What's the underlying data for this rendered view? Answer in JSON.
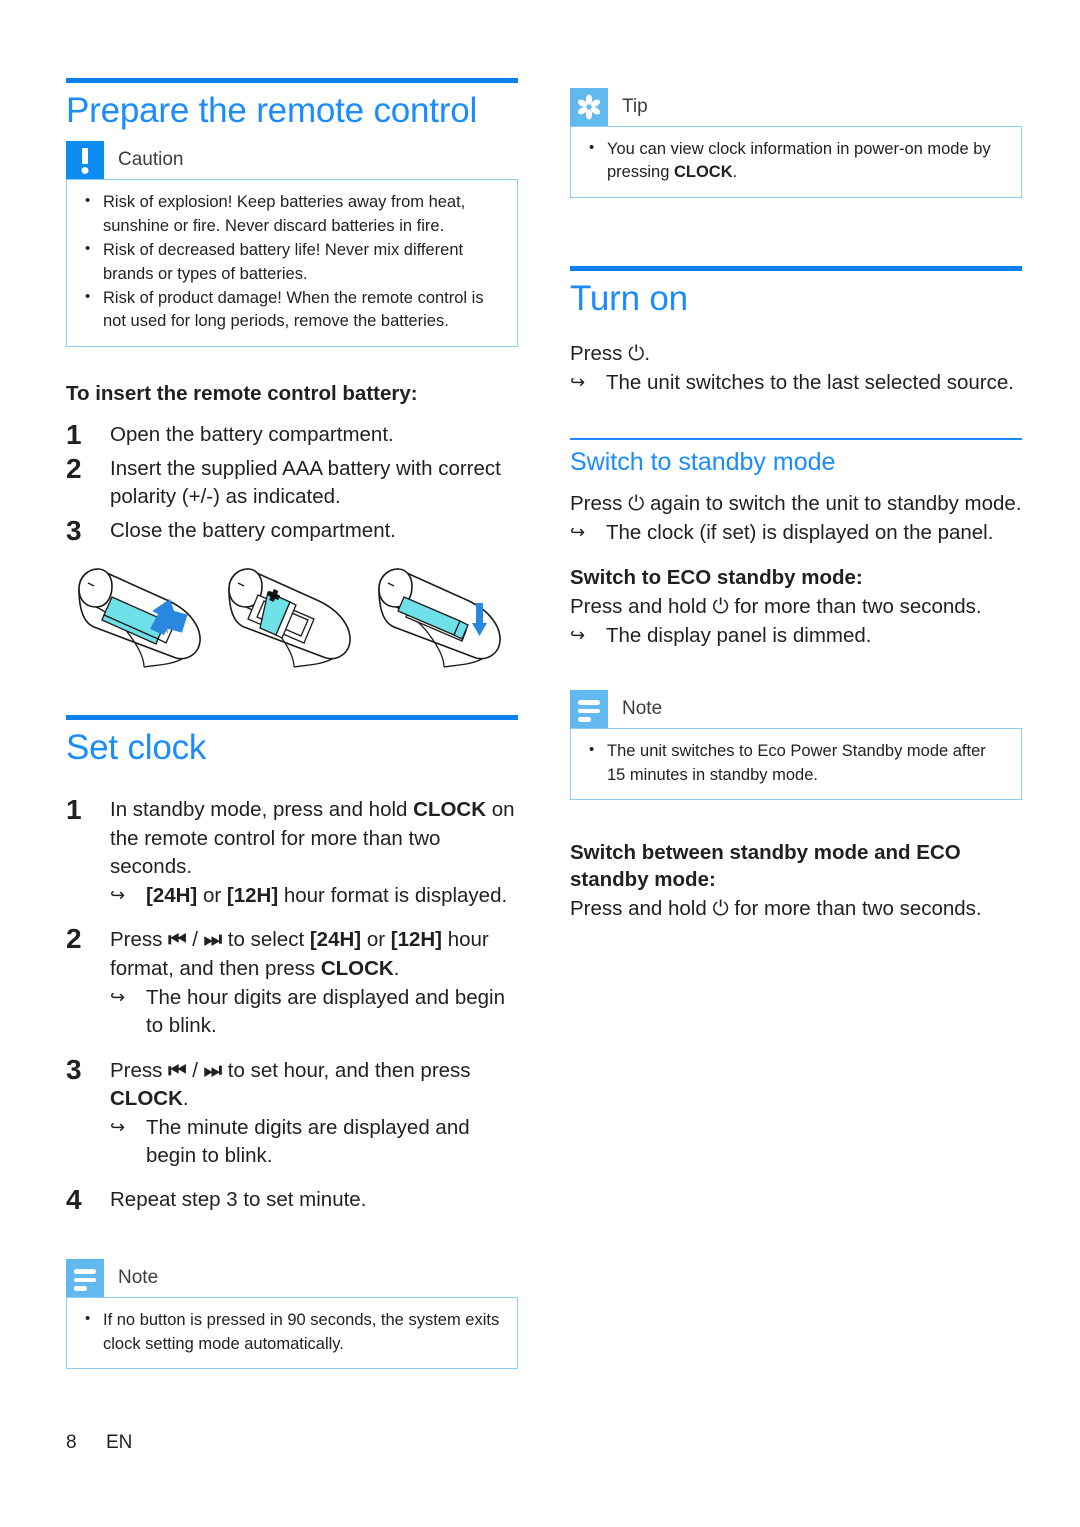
{
  "page": {
    "number": "8",
    "language": "EN"
  },
  "colors": {
    "heading_blue": "#1a8cff",
    "rule_blue": "#0b7fef",
    "caution_icon_blue": "#0b8cf0",
    "note_icon_blue": "#62b9ef",
    "callout_border": "#8ecdf2",
    "body_text": "#231f20",
    "illustration_accent": "#6ee0e8",
    "illustration_arrow": "#1a7fe0"
  },
  "left_column": {
    "section_prepare": {
      "title": "Prepare the remote control",
      "caution": {
        "label": "Caution",
        "icon": "exclamation-icon",
        "items": [
          "Risk of explosion! Keep batteries away from heat, sunshine or fire. Never discard batteries in fire.",
          "Risk of decreased battery life! Never mix different brands or types of batteries.",
          "Risk of product damage! When the remote control is not used for long periods, remove the batteries."
        ]
      },
      "subheading": "To insert the remote control battery:",
      "steps": [
        {
          "num": "1",
          "text": "Open the battery compartment."
        },
        {
          "num": "2",
          "text": "Insert the supplied AAA battery with correct polarity (+/-) as indicated."
        },
        {
          "num": "3",
          "text": "Close the battery compartment."
        }
      ],
      "illustrations": [
        "remote-open-compartment-illustration",
        "remote-insert-battery-illustration",
        "remote-close-compartment-illustration"
      ]
    },
    "section_set_clock": {
      "title": "Set clock",
      "steps": [
        {
          "num": "1",
          "text_parts": [
            {
              "t": "In standby mode, press and hold ",
              "b": false
            },
            {
              "t": "CLOCK",
              "b": true
            },
            {
              "t": " on the remote control for more than two seconds.",
              "b": false
            }
          ],
          "results": [
            [
              {
                "t": "[24H]",
                "b": true
              },
              {
                "t": " or ",
                "b": false
              },
              {
                "t": "[12H]",
                "b": true
              },
              {
                "t": " hour format is displayed.",
                "b": false
              }
            ]
          ]
        },
        {
          "num": "2",
          "text_parts": [
            {
              "t": "Press ",
              "b": false
            },
            {
              "t": "⏮",
              "b": true,
              "sym": true
            },
            {
              "t": " / ",
              "b": false
            },
            {
              "t": "⏭",
              "b": true,
              "sym": true
            },
            {
              "t": " to select ",
              "b": false
            },
            {
              "t": "[24H]",
              "b": true
            },
            {
              "t": " or ",
              "b": false
            },
            {
              "t": "[12H]",
              "b": true
            },
            {
              "t": " hour format, and then press ",
              "b": false
            },
            {
              "t": "CLOCK",
              "b": true
            },
            {
              "t": ".",
              "b": false
            }
          ],
          "results": [
            [
              {
                "t": "The hour digits are displayed and begin to blink.",
                "b": false
              }
            ]
          ]
        },
        {
          "num": "3",
          "text_parts": [
            {
              "t": "Press ",
              "b": false
            },
            {
              "t": "⏮",
              "b": true,
              "sym": true
            },
            {
              "t": " / ",
              "b": false
            },
            {
              "t": "⏭",
              "b": true,
              "sym": true
            },
            {
              "t": " to set hour, and then press ",
              "b": false
            },
            {
              "t": "CLOCK",
              "b": true
            },
            {
              "t": ".",
              "b": false
            }
          ],
          "results": [
            [
              {
                "t": "The minute digits are displayed and begin to blink.",
                "b": false
              }
            ]
          ]
        },
        {
          "num": "4",
          "text_parts": [
            {
              "t": "Repeat step 3 to set minute.",
              "b": false
            }
          ],
          "results": []
        }
      ],
      "note": {
        "label": "Note",
        "icon": "note-lines-icon",
        "items": [
          "If no button is pressed in 90 seconds, the system exits clock setting mode automatically."
        ]
      }
    }
  },
  "right_column": {
    "tip": {
      "label": "Tip",
      "icon": "asterisk-icon",
      "items_parts": [
        [
          {
            "t": "You can view clock information in power-on mode by pressing ",
            "b": false
          },
          {
            "t": "CLOCK",
            "b": true
          },
          {
            "t": ".",
            "b": false
          }
        ]
      ]
    },
    "section_turn_on": {
      "title": "Turn on",
      "body_parts": [
        {
          "t": "Press ",
          "b": false
        },
        {
          "t": "⏻",
          "b": false,
          "sym": true
        },
        {
          "t": ".",
          "b": false
        }
      ],
      "results": [
        [
          {
            "t": "The unit switches to the last selected source.",
            "b": false
          }
        ]
      ]
    },
    "section_standby": {
      "title": "Switch to standby mode",
      "body_parts": [
        {
          "t": "Press ",
          "b": false
        },
        {
          "t": "⏻",
          "b": false,
          "sym": true
        },
        {
          "t": " again to switch the unit to standby mode.",
          "b": false
        }
      ],
      "results": [
        [
          {
            "t": "The clock (if set) is displayed on the panel.",
            "b": false
          }
        ]
      ],
      "eco": {
        "heading": "Switch to ECO standby mode:",
        "body_parts": [
          {
            "t": "Press and hold ",
            "b": false
          },
          {
            "t": "⏻",
            "b": false,
            "sym": true
          },
          {
            "t": " for more than two seconds.",
            "b": false
          }
        ],
        "results": [
          [
            {
              "t": "The display panel is dimmed.",
              "b": false
            }
          ]
        ]
      },
      "note": {
        "label": "Note",
        "icon": "note-lines-icon",
        "items": [
          "The unit switches to Eco Power Standby mode after 15 minutes in standby mode."
        ]
      },
      "switch_between": {
        "heading": "Switch between standby mode and ECO standby mode:",
        "body_parts": [
          {
            "t": "Press and hold ",
            "b": false
          },
          {
            "t": "⏻",
            "b": false,
            "sym": true
          },
          {
            "t": " for more than two seconds.",
            "b": false
          }
        ]
      }
    }
  }
}
